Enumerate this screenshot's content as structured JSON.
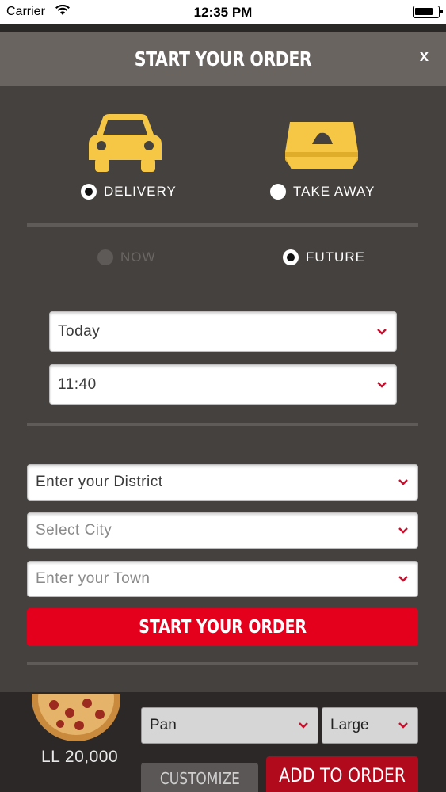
{
  "status_bar": {
    "carrier": "Carrier",
    "time": "12:35 PM"
  },
  "modal": {
    "title": "START YOUR ORDER",
    "close_label": "x"
  },
  "order_type": {
    "delivery_label": "DELIVERY",
    "takeaway_label": "TAKE AWAY",
    "selected": "delivery"
  },
  "timing": {
    "now_label": "NOW",
    "future_label": "FUTURE",
    "selected": "future"
  },
  "schedule": {
    "day_value": "Today",
    "time_value": "11:40"
  },
  "address": {
    "district_value": "Enter your District",
    "city_placeholder": "Select City",
    "town_placeholder": "Enter your Town"
  },
  "start_button_label": "START YOUR ORDER",
  "product": {
    "price": "LL  20,000",
    "crust_value": "Pan",
    "size_value": "Large",
    "customize_label": "CUSTOMIZE",
    "add_label": "ADD TO ORDER"
  },
  "colors": {
    "accent_red": "#e4001c",
    "icon_yellow": "#f6c744",
    "modal_bg": "#45413e"
  }
}
